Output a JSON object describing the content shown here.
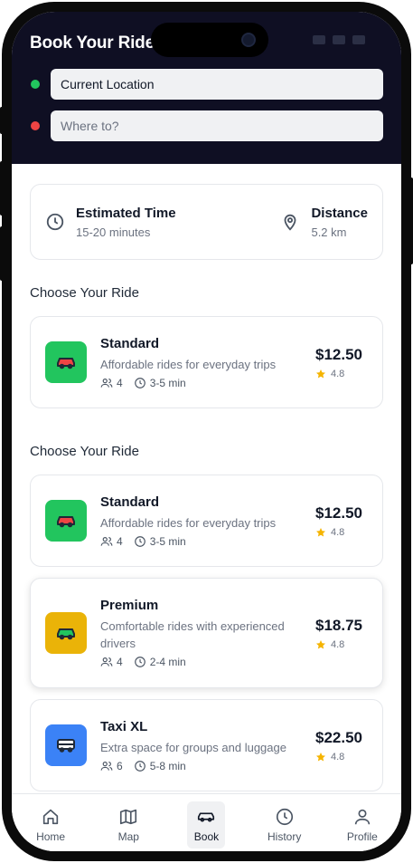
{
  "header": {
    "title": "Book Your Ride",
    "pickup": {
      "value": "Current Location",
      "dot_color": "#22c55e"
    },
    "destination": {
      "placeholder": "Where to?",
      "dot_color": "#ef4444"
    }
  },
  "trip_info": {
    "time": {
      "label": "Estimated Time",
      "value": "15-20 minutes",
      "icon": "clock-icon"
    },
    "distance": {
      "label": "Distance",
      "value": "5.2 km",
      "icon": "map-pin-icon"
    }
  },
  "section_1": {
    "title": "Choose Your Ride",
    "rides": [
      {
        "name": "Standard",
        "description": "Affordable rides for everyday trips",
        "passengers": "4",
        "eta": "3-5 min",
        "price": "$12.50",
        "rating": "4.8",
        "color": "#22c55e",
        "icon": "car-icon"
      }
    ]
  },
  "section_2": {
    "title": "Choose Your Ride",
    "rides": [
      {
        "name": "Standard",
        "description": "Affordable rides for everyday trips",
        "passengers": "4",
        "eta": "3-5 min",
        "price": "$12.50",
        "rating": "4.8",
        "color": "#22c55e",
        "icon": "car-icon"
      },
      {
        "name": "Premium",
        "description": "Comfortable rides with experienced drivers",
        "passengers": "4",
        "eta": "2-4 min",
        "price": "$18.75",
        "rating": "4.8",
        "color": "#eab308",
        "icon": "car-icon"
      },
      {
        "name": "Taxi XL",
        "description": "Extra space for groups and luggage",
        "passengers": "6",
        "eta": "5-8 min",
        "price": "$22.50",
        "rating": "4.8",
        "color": "#3b82f6",
        "icon": "van-icon"
      }
    ]
  },
  "tabbar": {
    "items": [
      {
        "label": "Home",
        "icon": "home-icon"
      },
      {
        "label": "Map",
        "icon": "map-icon"
      },
      {
        "label": "Book",
        "icon": "car-icon",
        "active": true
      },
      {
        "label": "History",
        "icon": "history-icon"
      },
      {
        "label": "Profile",
        "icon": "user-icon"
      }
    ]
  },
  "colors": {
    "header_bg": "#0f0f23",
    "star": "#f5b400"
  }
}
